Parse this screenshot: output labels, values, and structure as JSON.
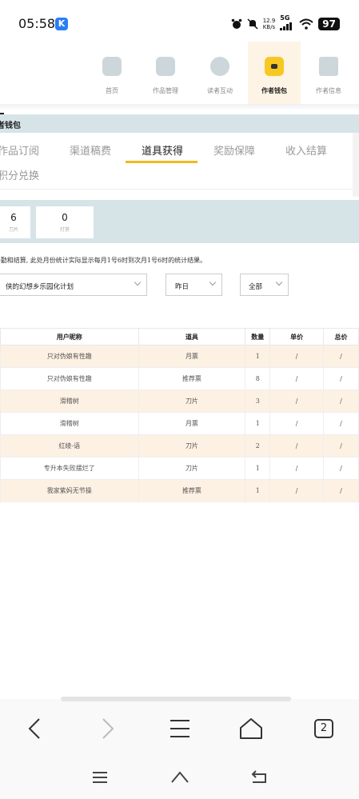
{
  "status": {
    "time": "05:58",
    "badge": "K",
    "net_speed": "12.9",
    "net_unit": "KB/s",
    "net_type": "5G",
    "battery": "97"
  },
  "nav": {
    "items": [
      {
        "label": "首页",
        "icon": "home-icon"
      },
      {
        "label": "作品管理",
        "icon": "book-icon"
      },
      {
        "label": "读者互动",
        "icon": "paw-icon"
      },
      {
        "label": "作者钱包",
        "icon": "wallet-icon"
      },
      {
        "label": "作者信息",
        "icon": "id-card-icon"
      }
    ]
  },
  "section": {
    "title": "者钱包"
  },
  "tabs": [
    {
      "label": "作品订阅"
    },
    {
      "label": "渠道稿费"
    },
    {
      "label": "道具获得"
    },
    {
      "label": "奖励保障"
    },
    {
      "label": "收入结算"
    },
    {
      "label": "积分兑换"
    }
  ],
  "stats": [
    {
      "value": "6",
      "label": "刀片"
    },
    {
      "value": "0",
      "label": "打赏"
    }
  ],
  "note": "-勤和结算, 此处月份统计实际显示每月1号6时到次月1号6时的统计结果。",
  "filters": {
    "book": "侠的幻想乡乐园化计划",
    "date": "昨日",
    "type": "全部"
  },
  "table": {
    "headers": [
      "用户昵称",
      "道具",
      "数量",
      "单价",
      "总价"
    ],
    "rows": [
      [
        "只对伪娘有性趣",
        "月票",
        "1",
        "/",
        "/"
      ],
      [
        "只对伪娘有性趣",
        "推荐票",
        "8",
        "/",
        "/"
      ],
      [
        "滑稽树",
        "刀片",
        "3",
        "/",
        "/"
      ],
      [
        "滑稽树",
        "月票",
        "1",
        "/",
        "/"
      ],
      [
        "红绫-语",
        "刀片",
        "2",
        "/",
        "/"
      ],
      [
        "专升本失败摆烂了",
        "刀片",
        "1",
        "/",
        "/"
      ],
      [
        "我家紫妈无节操",
        "推荐票",
        "1",
        "/",
        "/"
      ]
    ]
  },
  "browser": {
    "tab_count": "2"
  }
}
